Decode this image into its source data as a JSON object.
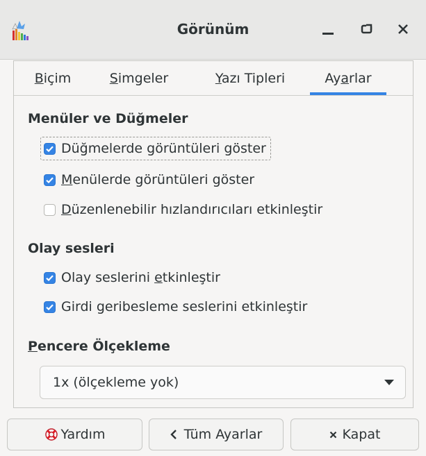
{
  "window": {
    "title": "Görünüm"
  },
  "tabs": [
    {
      "label": "Biçim",
      "mnemonic": "B",
      "rest": "içim",
      "active": false
    },
    {
      "label": "Simgeler",
      "mnemonic": "S",
      "rest": "imgeler",
      "active": false
    },
    {
      "label": "Yazı Tipleri",
      "mnemonic": "Y",
      "rest": "azı Tipleri",
      "active": false
    },
    {
      "label": "Ayarlar",
      "pre": "Ay",
      "mnemonic": "a",
      "rest": "rlar",
      "active": true
    }
  ],
  "menus_section": {
    "title": "Menüler ve Düğmeler",
    "items": [
      {
        "label": "Düğmelerde görüntüleri göster",
        "checked": true,
        "focused": true
      },
      {
        "label": "Menülerde görüntüleri göster",
        "mnemonic": "M",
        "rest": "enülerde görüntüleri göster",
        "checked": true
      },
      {
        "label": "Düzenlenebilir hızlandırıcıları etkinleştir",
        "mnemonic": "D",
        "rest": "üzenlenebilir hızlandırıcıları etkinleştir",
        "checked": false
      }
    ]
  },
  "sounds_section": {
    "title": "Olay sesleri",
    "items": [
      {
        "label": "Olay seslerini etkinleştir",
        "pre": "Olay seslerini ",
        "mnemonic": "e",
        "rest": "tkinleştir",
        "checked": true
      },
      {
        "label": "Girdi geribesleme seslerini etkinleştir",
        "checked": true
      }
    ]
  },
  "scaling_section": {
    "title": "Pencere Ölçekleme",
    "mnemonic": "P",
    "rest": "encere Ölçekleme",
    "selected": "1x (ölçekleme yok)"
  },
  "buttons": {
    "help": "Yardım",
    "all_settings": "Tüm Ayarlar",
    "close": "Kapat"
  },
  "colors": {
    "accent": "#3584e4",
    "background": "#f6f5f4",
    "titlebar": "#e8e8e7"
  }
}
